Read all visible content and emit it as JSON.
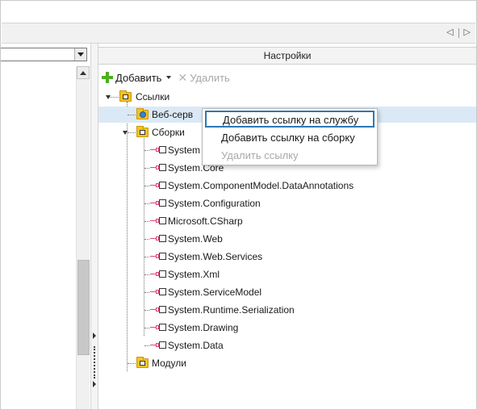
{
  "tab_nav": {
    "prev_icon": "chevron-left-icon",
    "next_icon": "chevron-right-icon"
  },
  "left_panel": {
    "combo_value": ""
  },
  "settings_panel": {
    "title": "Настройки",
    "toolbar": {
      "add_label": "Добавить",
      "remove_label": "Удалить"
    }
  },
  "tree": {
    "references_label": "Ссылки",
    "web_services_label": "Веб-серв",
    "assemblies_label": "Сборки",
    "assembly_items": [
      "System",
      "System.Core",
      "System.ComponentModel.DataAnnotations",
      "System.Configuration",
      "Microsoft.CSharp",
      "System.Web",
      "System.Web.Services",
      "System.Xml",
      "System.ServiceModel",
      "System.Runtime.Serialization",
      "System.Drawing",
      "System.Data"
    ],
    "modules_label": "Модули"
  },
  "context_menu": {
    "add_service_ref": "Добавить ссылку на службу",
    "add_assembly_ref": "Добавить ссылку на сборку",
    "remove_ref": "Удалить ссылку"
  },
  "colors": {
    "accent_green": "#4caf1f",
    "selection": "#dbe9f6",
    "menu_highlight_border": "#2b78b5",
    "folder": "#f6c31a"
  }
}
